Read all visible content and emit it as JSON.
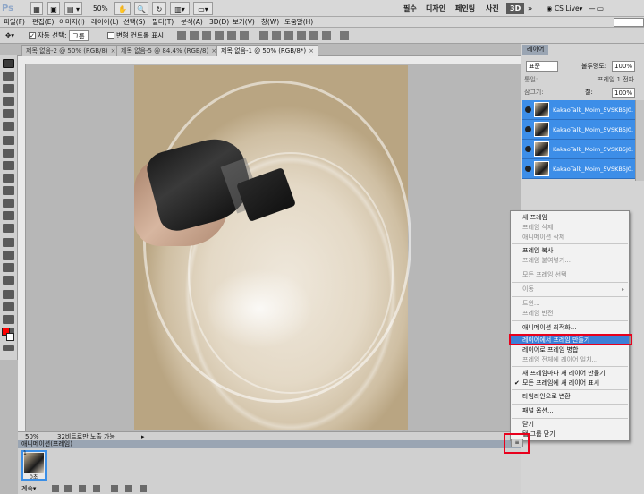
{
  "app": {
    "logo": "Ps"
  },
  "menubar": {
    "items": [
      "파일(F)",
      "편집(E)",
      "이미지(I)",
      "레이어(L)",
      "선택(S)",
      "필터(T)",
      "분석(A)",
      "3D(D)",
      "보기(V)",
      "창(W)",
      "도움말(H)"
    ],
    "zoom": "50%",
    "workspaces": [
      "필수",
      "디자인",
      "페인팅",
      "사진"
    ],
    "workspace_active": "3D",
    "more": "»",
    "cslive": "CS Live",
    "cslive_arrow": "▾"
  },
  "options": {
    "auto_select_label": "자동 선택:",
    "auto_select_value": "그룹",
    "transform_label": "변형 컨트롤 표시"
  },
  "doctabs": [
    {
      "label": "제목 없음-2 @ 50% (RGB/8)",
      "close": "×",
      "active": false
    },
    {
      "label": "제목 없음-5 @ 84.4% (RGB/8)",
      "close": "×",
      "active": false
    },
    {
      "label": "제목 없음-1 @ 50% (RGB/8*)",
      "close": "×",
      "active": true
    }
  ],
  "status": {
    "zoom": "50%",
    "info": "32비트로만 노출 가능",
    "arrow": "▸"
  },
  "animation": {
    "title": "애니메이션(프레임)",
    "frame_number": "1",
    "frame_time": "0초",
    "loop": "계속",
    "loop_arrow": "▾"
  },
  "layers_panel": {
    "tab": "레이어",
    "blend_mode": "표준",
    "opacity_label": "불투명도:",
    "opacity_value": "100%",
    "unify_label": "통일:",
    "frame1_label": "프레임 1 전파",
    "lock_label": "잠그기:",
    "fill_label": "칠:",
    "fill_value": "100%",
    "layers": [
      "KakaoTalk_Moim_5VSKB5J0...",
      "KakaoTalk_Moim_5VSKB5J0...",
      "KakaoTalk_Moim_5VSKB5J0...",
      "KakaoTalk_Moim_5VSKB5J0..."
    ]
  },
  "context_menu": {
    "items": [
      {
        "label": "새 프레임",
        "disabled": false
      },
      {
        "label": "프레임 삭제",
        "disabled": true
      },
      {
        "label": "애니메이션 삭제",
        "disabled": true
      },
      {
        "label": "프레임 복사",
        "disabled": false
      },
      {
        "label": "프레임 붙여넣기...",
        "disabled": true
      },
      {
        "label": "모든 프레임 선택",
        "disabled": true
      },
      {
        "label": "이동",
        "disabled": true,
        "submenu": "▸"
      },
      {
        "label": "트윈...",
        "disabled": true
      },
      {
        "label": "프레임 반전",
        "disabled": true
      },
      {
        "label": "애니메이션 최적화...",
        "disabled": false
      },
      {
        "label": "레이어에서 프레임 만들기",
        "disabled": false,
        "highlighted": true
      },
      {
        "label": "레이어로 프레임 병합",
        "disabled": false
      },
      {
        "label": "프레임 전체에 레이어 일치...",
        "disabled": true
      },
      {
        "label": "새 프레임마다 새 레이어 만들기",
        "disabled": false
      },
      {
        "label": "모든 프레임에 새 레이어 표시",
        "disabled": false,
        "checked": "✔"
      },
      {
        "label": "타임라인으로 변환",
        "disabled": false
      },
      {
        "label": "패널 옵션...",
        "disabled": false
      },
      {
        "label": "닫기",
        "disabled": false
      },
      {
        "label": "탭 그룹 닫기",
        "disabled": false
      }
    ]
  },
  "colors": {
    "accent": "#3d8ee8",
    "highlight_box": "#e8001c",
    "foreground": "#ff0000",
    "background": "#ffffff"
  }
}
